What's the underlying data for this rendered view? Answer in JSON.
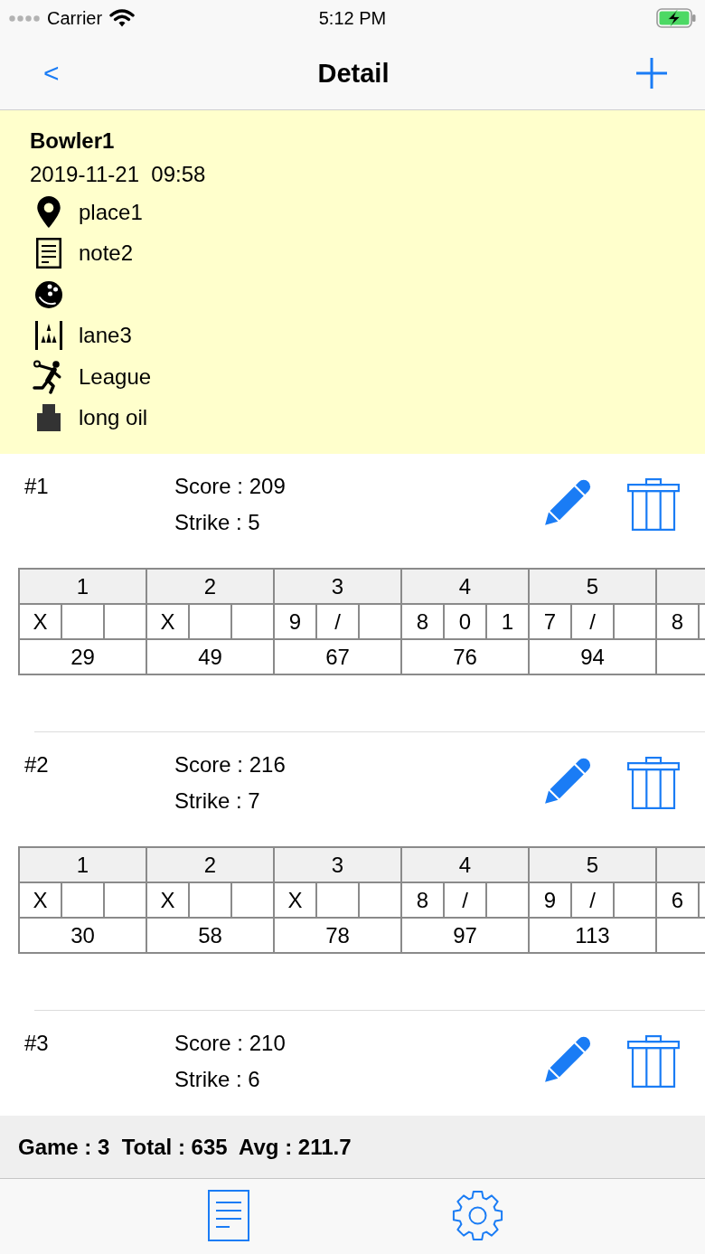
{
  "status_bar": {
    "carrier": "Carrier",
    "time": "5:12 PM"
  },
  "nav": {
    "back": "<",
    "title": "Detail"
  },
  "session": {
    "bowler": "Bowler1",
    "datetime": "2019-11-21  09:58",
    "details": [
      {
        "kind": "place",
        "text": "place1"
      },
      {
        "kind": "note",
        "text": "note2"
      },
      {
        "kind": "ball"
      },
      {
        "kind": "lane",
        "text": "lane3"
      },
      {
        "kind": "type",
        "text": "League"
      },
      {
        "kind": "oil",
        "text": "long oil"
      }
    ]
  },
  "games": [
    {
      "number": "#1",
      "score": "Score : 209",
      "strike": "Strike : 5",
      "frames": [
        {
          "number": "1",
          "rolls": [
            "X"
          ],
          "score": "29"
        },
        {
          "number": "2",
          "rolls": [
            "X"
          ],
          "score": "49"
        },
        {
          "number": "3",
          "rolls": [
            "9",
            "/"
          ],
          "score": "67"
        },
        {
          "number": "4",
          "rolls": [
            "8",
            "0",
            "1"
          ],
          "score": "76"
        },
        {
          "number": "5",
          "rolls": [
            "7",
            "/"
          ],
          "score": "94"
        },
        {
          "rolls": [
            "8"
          ]
        }
      ]
    },
    {
      "number": "#2",
      "score": "Score : 216",
      "strike": "Strike : 7",
      "frames": [
        {
          "number": "1",
          "rolls": [
            "X"
          ],
          "score": "30"
        },
        {
          "number": "2",
          "rolls": [
            "X"
          ],
          "score": "58"
        },
        {
          "number": "3",
          "rolls": [
            "X"
          ],
          "score": "78"
        },
        {
          "number": "4",
          "rolls": [
            "8",
            "/"
          ],
          "score": "97"
        },
        {
          "number": "5",
          "rolls": [
            "9",
            "/"
          ],
          "score": "113"
        },
        {
          "rolls": [
            "6"
          ]
        }
      ]
    },
    {
      "number": "#3",
      "score": "Score : 210",
      "strike": "Strike : 6"
    }
  ],
  "summary": "Game : 3  Total : 635  Avg : 211.7",
  "tab_bar": [
    {
      "kind": "list"
    },
    {
      "kind": "settings"
    }
  ]
}
